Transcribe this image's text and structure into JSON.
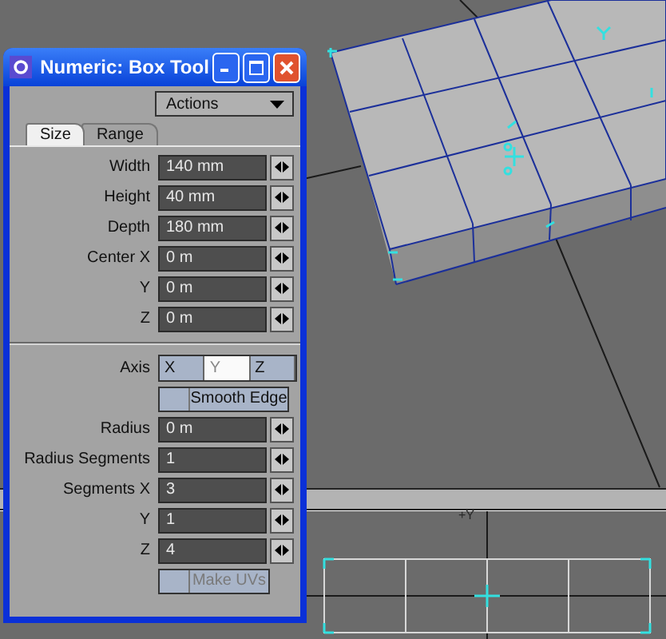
{
  "viewport": {
    "axis_label": "+Y"
  },
  "window": {
    "title": "Numeric: Box Tool"
  },
  "actions_dropdown": {
    "value": "Actions"
  },
  "tabs": [
    {
      "label": "Size",
      "selected": true
    },
    {
      "label": "Range",
      "selected": false
    }
  ],
  "size_fields": [
    {
      "label": "Width",
      "value": "140 mm"
    },
    {
      "label": "Height",
      "value": "40 mm"
    },
    {
      "label": "Depth",
      "value": "180 mm"
    },
    {
      "label": "Center X",
      "value": "0 m"
    },
    {
      "label": "Y",
      "value": "0 m"
    },
    {
      "label": "Z",
      "value": "0 m"
    }
  ],
  "axis": {
    "label": "Axis",
    "options": [
      {
        "label": "X",
        "selected": false
      },
      {
        "label": "Y",
        "selected": true
      },
      {
        "label": "Z",
        "selected": false
      }
    ]
  },
  "smooth_edge": {
    "label": "Smooth Edge",
    "checked": false
  },
  "segment_fields": [
    {
      "label": "Radius",
      "value": "0 m"
    },
    {
      "label": "Radius Segments",
      "value": "1"
    },
    {
      "label": "Segments X",
      "value": "3"
    },
    {
      "label": "Y",
      "value": "1"
    },
    {
      "label": "Z",
      "value": "4"
    }
  ],
  "make_uvs": {
    "label": "Make UVs",
    "checked": false,
    "disabled": true
  }
}
